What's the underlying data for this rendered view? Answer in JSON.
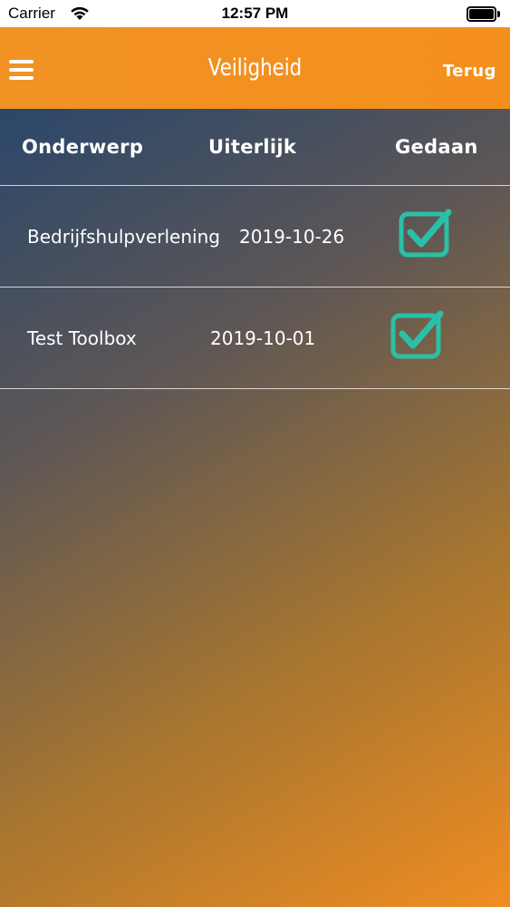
{
  "status_bar": {
    "carrier": "Carrier",
    "time": "12:57 PM",
    "wifi_icon": "wifi-icon",
    "battery_icon": "battery-icon"
  },
  "nav": {
    "title": "Veiligheid",
    "back_label": "Terug",
    "menu_icon": "hamburger-menu-icon",
    "bar_color": "#f39020"
  },
  "table": {
    "headers": {
      "subject": "Onderwerp",
      "due": "Uiterlijk",
      "done": "Gedaan"
    },
    "rows": [
      {
        "subject": "Bedrijfshulpverlening",
        "due": "2019-10-26",
        "done": true
      },
      {
        "subject": "Test Toolbox",
        "due": "2019-10-01",
        "done": true
      }
    ],
    "check_color": "#2ac0a8"
  }
}
